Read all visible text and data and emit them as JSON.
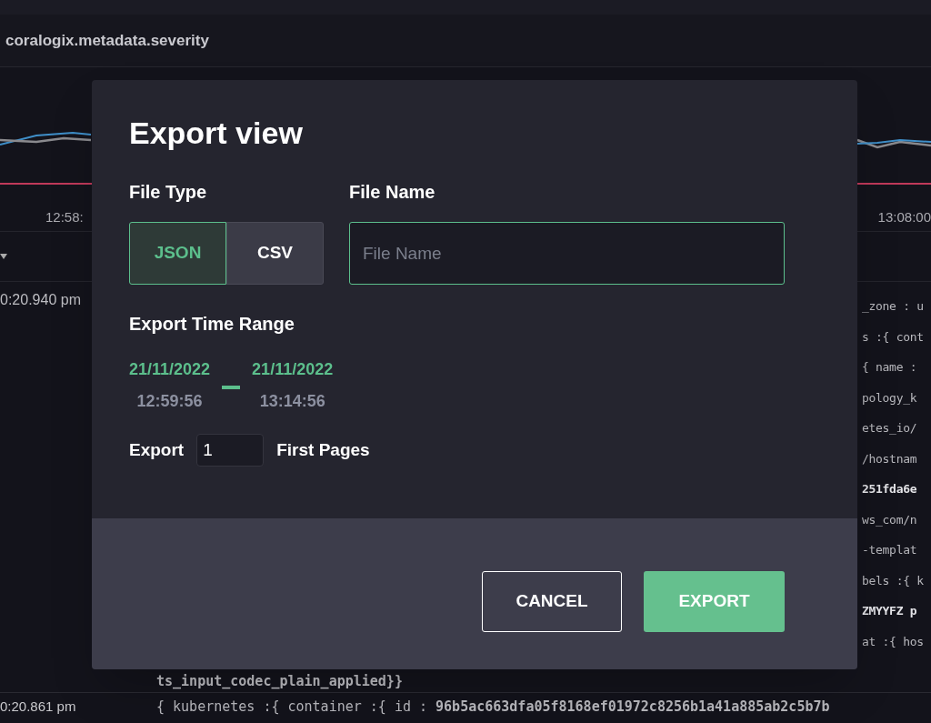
{
  "background": {
    "field_header": "coralogix.metadata.severity",
    "axis_labels": [
      "12:58:",
      "13:08:00"
    ],
    "left_times": [
      "0:20.940 pm"
    ],
    "right_fragments": [
      {
        "text": "_zone : u",
        "bold": false
      },
      {
        "text": "s :{ cont",
        "bold": false
      },
      {
        "text": "{ name :",
        "bold": false
      },
      {
        "text": "pology_k",
        "bold": false
      },
      {
        "text": "etes_io/",
        "bold": false
      },
      {
        "text": "/hostnam",
        "bold": false
      },
      {
        "text": "251fda6e",
        "bold": true
      },
      {
        "text": "ws_com/n",
        "bold": false
      },
      {
        "text": "-templat",
        "bold": false
      },
      {
        "text": "bels :{ k",
        "bold": false
      },
      {
        "text": "ZMYYFZ p",
        "bold": true
      },
      {
        "text": "at :{ hos",
        "bold": false
      }
    ],
    "cut_line": "ts_input_codec_plain_applied}}",
    "bottom_row": {
      "time": "0:20.861 pm",
      "content": "{ kubernetes :{ container :{ id : **96b5ac663dfa05f8168ef01972c8256b1a41a885ab2c5b7b**"
    }
  },
  "dialog": {
    "title": "Export view",
    "file_type": {
      "label": "File Type",
      "options": [
        {
          "label": "JSON",
          "selected": true
        },
        {
          "label": "CSV",
          "selected": false
        }
      ]
    },
    "file_name": {
      "label": "File Name",
      "placeholder": "File Name"
    },
    "time_range": {
      "label": "Export Time Range",
      "start": {
        "date": "21/11/2022",
        "time": "12:59:56"
      },
      "end": {
        "date": "21/11/2022",
        "time": "13:14:56"
      }
    },
    "pages": {
      "prefix": "Export",
      "value": "1",
      "suffix": "First Pages"
    },
    "buttons": {
      "cancel": "CANCEL",
      "export": "EXPORT"
    }
  }
}
